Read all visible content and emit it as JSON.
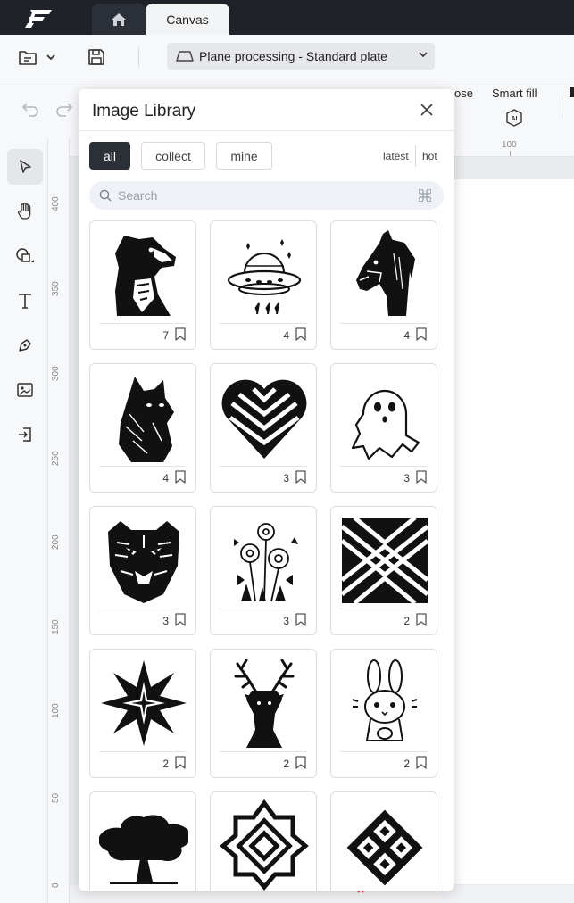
{
  "titlebar": {
    "tab_home_icon": "home-icon",
    "tab_canvas": "Canvas"
  },
  "toolbar": {
    "mode_select": "Plane processing - Standard plate"
  },
  "rightbar": {
    "close_label": "ose",
    "smart_fill_label": "Smart fill"
  },
  "ruler": {
    "vertical": [
      "400",
      "350",
      "300",
      "250",
      "200",
      "150",
      "100",
      "50",
      "0"
    ],
    "horizontal": [
      "100"
    ]
  },
  "library": {
    "title": "Image Library",
    "filters": [
      "all",
      "collect",
      "mine"
    ],
    "active_filter": "all",
    "sort": [
      "latest",
      "hot"
    ],
    "search_placeholder": "Search",
    "items": [
      {
        "name": "dog",
        "count": "7"
      },
      {
        "name": "ufo",
        "count": "4"
      },
      {
        "name": "horse",
        "count": "4"
      },
      {
        "name": "cat",
        "count": "4"
      },
      {
        "name": "striped-heart",
        "count": "3"
      },
      {
        "name": "ghost",
        "count": "3"
      },
      {
        "name": "tiger",
        "count": "3"
      },
      {
        "name": "flowers",
        "count": "3"
      },
      {
        "name": "chevron-pattern",
        "count": "2"
      },
      {
        "name": "star",
        "count": "2"
      },
      {
        "name": "deer",
        "count": "2"
      },
      {
        "name": "bunny",
        "count": "2"
      },
      {
        "name": "tree",
        "count": ""
      },
      {
        "name": "geometric-star",
        "count": ""
      },
      {
        "name": "diamond-knot",
        "count": ""
      }
    ]
  },
  "colors": {
    "titlebar": "#1f2329",
    "accent_dark": "#2b2f36",
    "panel_bg": "#ffffff"
  }
}
